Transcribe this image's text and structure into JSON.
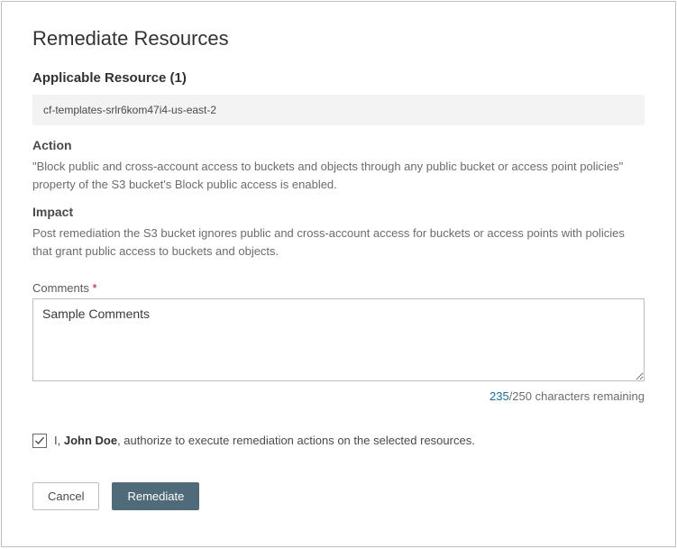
{
  "title": "Remediate Resources",
  "applicable": {
    "label": "Applicable Resource (1)",
    "resource": "cf-templates-srlr6kom47i4-us-east-2"
  },
  "action": {
    "heading": "Action",
    "text": "\"Block public and cross-account access to buckets and objects through any public bucket or access point policies\" property of the S3 bucket's Block public access is enabled."
  },
  "impact": {
    "heading": "Impact",
    "text": "Post remediation the S3 bucket ignores public and cross-account access for buckets or access points with policies that grant public access to buckets and objects."
  },
  "comments": {
    "label": "Comments",
    "required_marker": "*",
    "value": "Sample Comments",
    "remaining_num": "235",
    "remaining_suffix": "/250 characters remaining"
  },
  "authorize": {
    "prefix": "I, ",
    "name": "John Doe",
    "suffix": ", authorize to execute remediation actions on the selected resources."
  },
  "buttons": {
    "cancel": "Cancel",
    "remediate": "Remediate"
  }
}
